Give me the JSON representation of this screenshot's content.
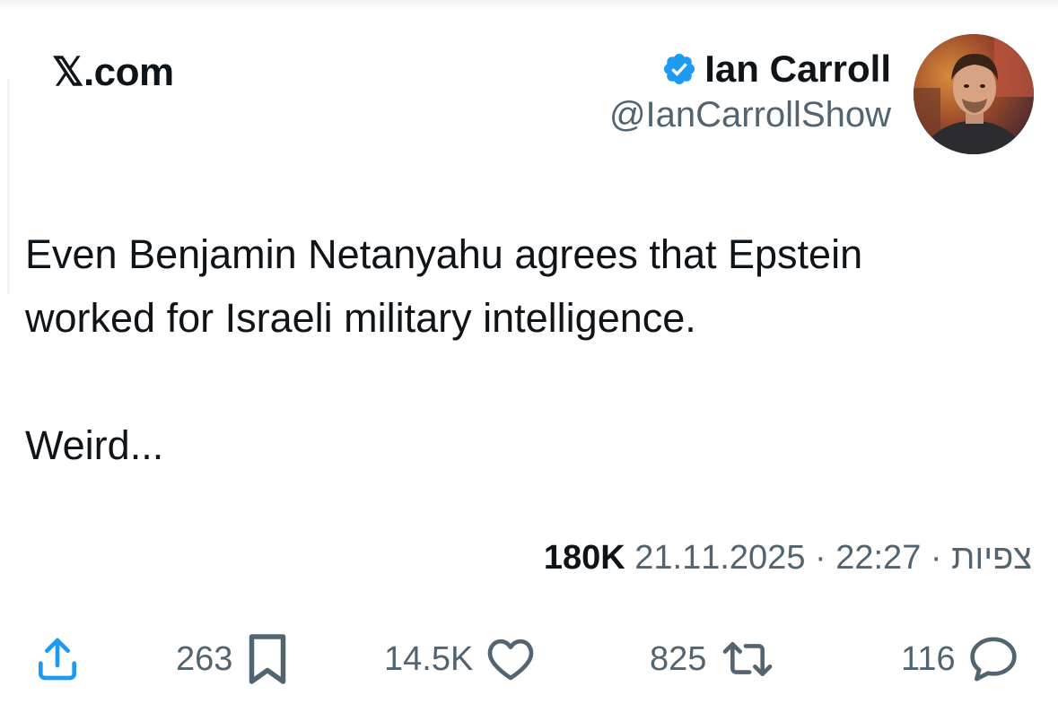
{
  "header": {
    "site": "𝕏.com",
    "display_name": "Ian Carroll",
    "handle": "@IanCarrollShow",
    "verified_icon": "verified-badge-icon",
    "accent_color": "#1d9bf0"
  },
  "tweet": {
    "text": "Even Benjamin Netanyahu agrees that Epstein\nworked for Israeli military intelligence.\n\nWeird..."
  },
  "meta": {
    "views_count": "180K",
    "views_label": "צפיות",
    "separator": "·",
    "time": "22:27",
    "date": "21.11.2025"
  },
  "actions": {
    "share_icon": "share-icon",
    "bookmarks": "263",
    "likes": "14.5K",
    "reposts": "825",
    "replies": "116"
  }
}
